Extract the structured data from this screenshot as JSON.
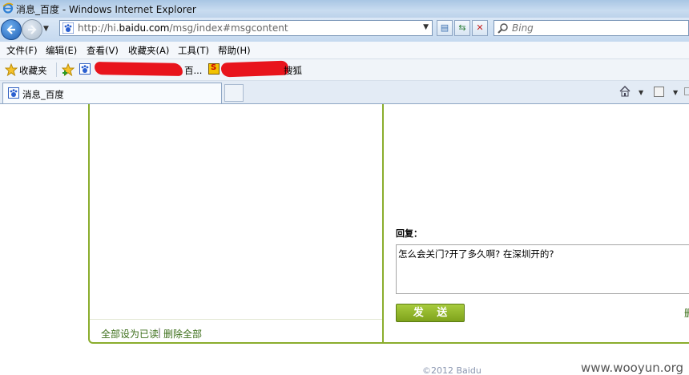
{
  "window": {
    "title": "消息_百度 - Windows Internet Explorer"
  },
  "address_bar": {
    "url_prefix": "http://hi.",
    "url_domain": "baidu.com",
    "url_path": "/msg/index#msgcontent"
  },
  "search": {
    "placeholder": "Bing"
  },
  "menu": {
    "items": [
      "文件(F)",
      "编辑(E)",
      "查看(V)",
      "收藏夹(A)",
      "工具(T)",
      "帮助(H)"
    ]
  },
  "favorites": {
    "label": "收藏夹",
    "item1_suffix": "百...",
    "item2_suffix": "搜狐"
  },
  "tabs": [
    {
      "label": "消息_百度",
      "active": true
    }
  ],
  "content": {
    "footer_links": {
      "mark_all_read": "全部设为已读",
      "separator": "|",
      "delete_all": "删除全部"
    },
    "reply": {
      "label": "回复：",
      "text": "怎么会关门?开了多久啊? 在深圳开的?",
      "send_button": "发 送",
      "side_link": "删"
    },
    "copyright": "©2012 Baidu"
  },
  "watermark": "www.wooyun.org",
  "colors": {
    "accent_green": "#8aad2c",
    "link_green": "#3b6e18",
    "redaction": "#e8141c",
    "ie_chrome": "#c5d9ef"
  }
}
